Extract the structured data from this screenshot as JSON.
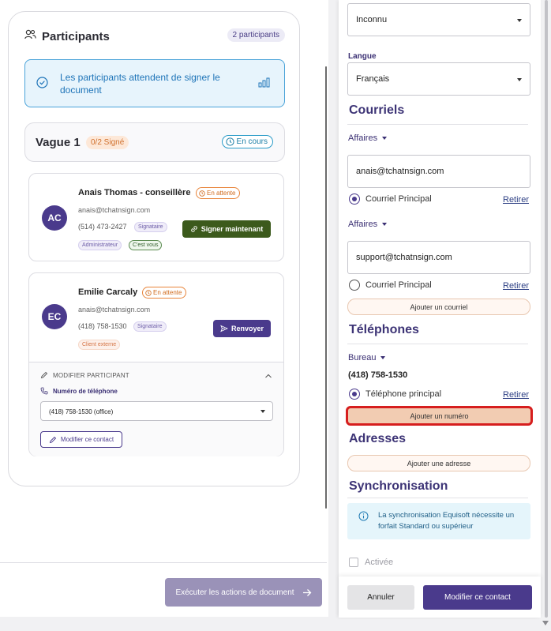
{
  "participants": {
    "title": "Participants",
    "count_badge": "2 participants",
    "info_message": "Les participants attendent de signer le document",
    "wave": {
      "title": "Vague 1",
      "signed": "0/2 Signé",
      "status": "En cours"
    },
    "list": [
      {
        "initials": "AC",
        "name": "Anais Thomas - conseillère",
        "status": "En attente",
        "email": "anais@tchatnsign.com",
        "phone": "(514) 473-2427",
        "tags": [
          "Signataire",
          "Administrateur",
          "C'est vous"
        ],
        "action": "Signer maintenant"
      },
      {
        "initials": "EC",
        "name": "Emilie Carcaly",
        "status": "En attente",
        "email": "anais@tchatnsign.com",
        "phone": "(418) 758-1530",
        "tags": [
          "Signataire",
          "Client externe"
        ],
        "action": "Renvoyer"
      }
    ],
    "edit": {
      "title": "MODIFIER PARTICIPANT",
      "phone_label": "Numéro de téléphone",
      "phone_value": "(418) 758-1530 (office)",
      "modify_button": "Modifier ce contact"
    },
    "execute_button": "Exécuter les actions de document"
  },
  "contact_form": {
    "gender_value": "Inconnu",
    "language_label": "Langue",
    "language_value": "Français",
    "emails_section": "Courriels",
    "emails": [
      {
        "type": "Affaires",
        "value": "anais@tchatnsign.com",
        "primary_label": "Courriel Principal",
        "is_primary": true,
        "remove": "Retirer"
      },
      {
        "type": "Affaires",
        "value": "support@tchatnsign.com",
        "primary_label": "Courriel Principal",
        "is_primary": false,
        "remove": "Retirer"
      }
    ],
    "add_email": "Ajouter un courriel",
    "phones_section": "Téléphones",
    "phone": {
      "type": "Bureau",
      "value": "(418) 758-1530",
      "primary_label": "Téléphone principal",
      "remove": "Retirer"
    },
    "add_phone": "Ajouter un numéro",
    "addresses_section": "Adresses",
    "add_address": "Ajouter une adresse",
    "sync_section": "Synchronisation",
    "sync_info": "La synchronisation Equisoft nécessite un forfait Standard ou supérieur",
    "sync_checkbox": "Activée",
    "cancel_button": "Annuler",
    "save_button": "Modifier ce contact"
  },
  "colors": {
    "brand_purple": "#4a3a8c",
    "sign_green": "#3c5a1c",
    "highlight_red": "#d61e1e"
  }
}
